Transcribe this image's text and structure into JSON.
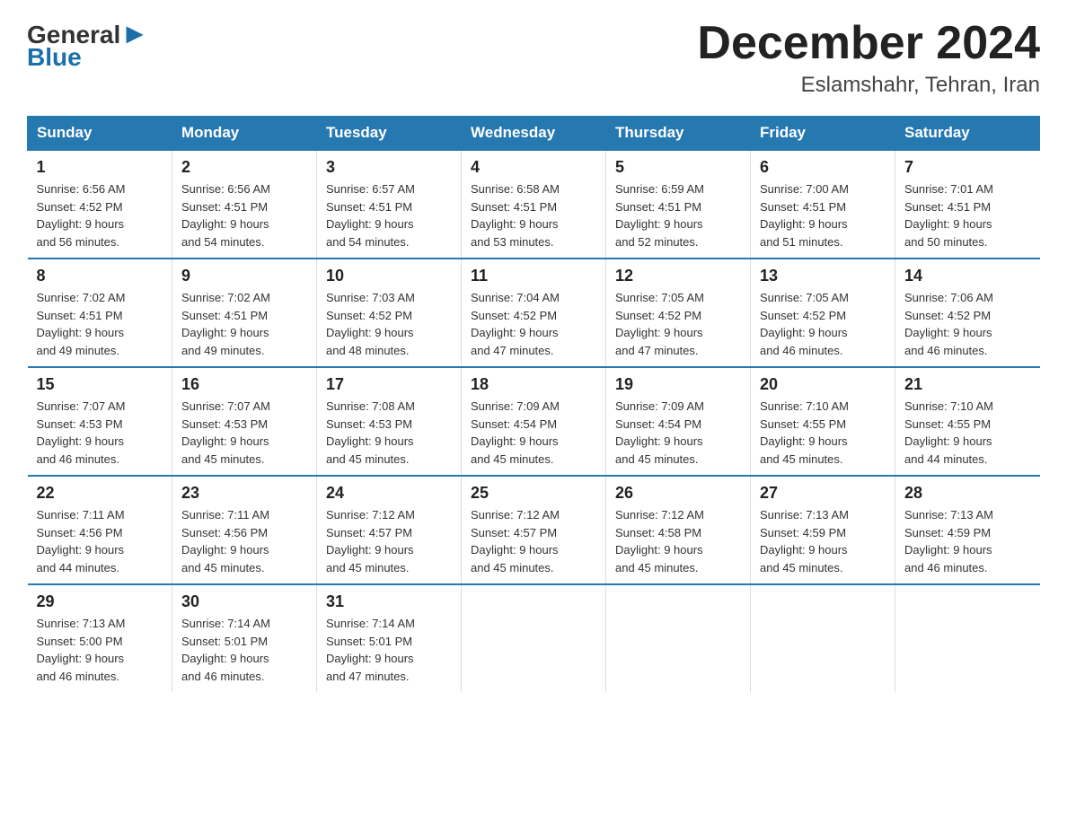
{
  "header": {
    "logo_general": "General",
    "logo_blue": "Blue",
    "month_title": "December 2024",
    "location": "Eslamshahr, Tehran, Iran"
  },
  "days_of_week": [
    "Sunday",
    "Monday",
    "Tuesday",
    "Wednesday",
    "Thursday",
    "Friday",
    "Saturday"
  ],
  "weeks": [
    [
      {
        "day": "1",
        "sunrise": "6:56 AM",
        "sunset": "4:52 PM",
        "daylight": "9 hours and 56 minutes."
      },
      {
        "day": "2",
        "sunrise": "6:56 AM",
        "sunset": "4:51 PM",
        "daylight": "9 hours and 54 minutes."
      },
      {
        "day": "3",
        "sunrise": "6:57 AM",
        "sunset": "4:51 PM",
        "daylight": "9 hours and 54 minutes."
      },
      {
        "day": "4",
        "sunrise": "6:58 AM",
        "sunset": "4:51 PM",
        "daylight": "9 hours and 53 minutes."
      },
      {
        "day": "5",
        "sunrise": "6:59 AM",
        "sunset": "4:51 PM",
        "daylight": "9 hours and 52 minutes."
      },
      {
        "day": "6",
        "sunrise": "7:00 AM",
        "sunset": "4:51 PM",
        "daylight": "9 hours and 51 minutes."
      },
      {
        "day": "7",
        "sunrise": "7:01 AM",
        "sunset": "4:51 PM",
        "daylight": "9 hours and 50 minutes."
      }
    ],
    [
      {
        "day": "8",
        "sunrise": "7:02 AM",
        "sunset": "4:51 PM",
        "daylight": "9 hours and 49 minutes."
      },
      {
        "day": "9",
        "sunrise": "7:02 AM",
        "sunset": "4:51 PM",
        "daylight": "9 hours and 49 minutes."
      },
      {
        "day": "10",
        "sunrise": "7:03 AM",
        "sunset": "4:52 PM",
        "daylight": "9 hours and 48 minutes."
      },
      {
        "day": "11",
        "sunrise": "7:04 AM",
        "sunset": "4:52 PM",
        "daylight": "9 hours and 47 minutes."
      },
      {
        "day": "12",
        "sunrise": "7:05 AM",
        "sunset": "4:52 PM",
        "daylight": "9 hours and 47 minutes."
      },
      {
        "day": "13",
        "sunrise": "7:05 AM",
        "sunset": "4:52 PM",
        "daylight": "9 hours and 46 minutes."
      },
      {
        "day": "14",
        "sunrise": "7:06 AM",
        "sunset": "4:52 PM",
        "daylight": "9 hours and 46 minutes."
      }
    ],
    [
      {
        "day": "15",
        "sunrise": "7:07 AM",
        "sunset": "4:53 PM",
        "daylight": "9 hours and 46 minutes."
      },
      {
        "day": "16",
        "sunrise": "7:07 AM",
        "sunset": "4:53 PM",
        "daylight": "9 hours and 45 minutes."
      },
      {
        "day": "17",
        "sunrise": "7:08 AM",
        "sunset": "4:53 PM",
        "daylight": "9 hours and 45 minutes."
      },
      {
        "day": "18",
        "sunrise": "7:09 AM",
        "sunset": "4:54 PM",
        "daylight": "9 hours and 45 minutes."
      },
      {
        "day": "19",
        "sunrise": "7:09 AM",
        "sunset": "4:54 PM",
        "daylight": "9 hours and 45 minutes."
      },
      {
        "day": "20",
        "sunrise": "7:10 AM",
        "sunset": "4:55 PM",
        "daylight": "9 hours and 45 minutes."
      },
      {
        "day": "21",
        "sunrise": "7:10 AM",
        "sunset": "4:55 PM",
        "daylight": "9 hours and 44 minutes."
      }
    ],
    [
      {
        "day": "22",
        "sunrise": "7:11 AM",
        "sunset": "4:56 PM",
        "daylight": "9 hours and 44 minutes."
      },
      {
        "day": "23",
        "sunrise": "7:11 AM",
        "sunset": "4:56 PM",
        "daylight": "9 hours and 45 minutes."
      },
      {
        "day": "24",
        "sunrise": "7:12 AM",
        "sunset": "4:57 PM",
        "daylight": "9 hours and 45 minutes."
      },
      {
        "day": "25",
        "sunrise": "7:12 AM",
        "sunset": "4:57 PM",
        "daylight": "9 hours and 45 minutes."
      },
      {
        "day": "26",
        "sunrise": "7:12 AM",
        "sunset": "4:58 PM",
        "daylight": "9 hours and 45 minutes."
      },
      {
        "day": "27",
        "sunrise": "7:13 AM",
        "sunset": "4:59 PM",
        "daylight": "9 hours and 45 minutes."
      },
      {
        "day": "28",
        "sunrise": "7:13 AM",
        "sunset": "4:59 PM",
        "daylight": "9 hours and 46 minutes."
      }
    ],
    [
      {
        "day": "29",
        "sunrise": "7:13 AM",
        "sunset": "5:00 PM",
        "daylight": "9 hours and 46 minutes."
      },
      {
        "day": "30",
        "sunrise": "7:14 AM",
        "sunset": "5:01 PM",
        "daylight": "9 hours and 46 minutes."
      },
      {
        "day": "31",
        "sunrise": "7:14 AM",
        "sunset": "5:01 PM",
        "daylight": "9 hours and 47 minutes."
      },
      null,
      null,
      null,
      null
    ]
  ],
  "labels": {
    "sunrise": "Sunrise:",
    "sunset": "Sunset:",
    "daylight": "Daylight:"
  }
}
